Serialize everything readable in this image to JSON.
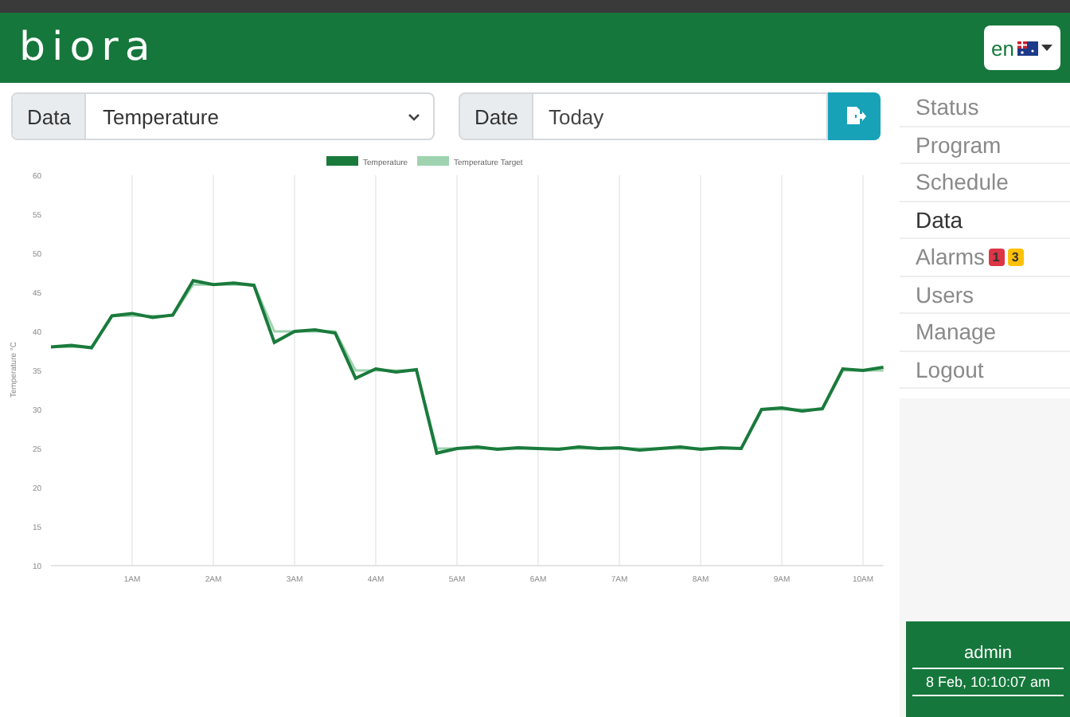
{
  "header": {
    "logo": "biora",
    "language": "en"
  },
  "controls": {
    "data_label": "Data",
    "data_value": "Temperature",
    "date_label": "Date",
    "date_value": "Today"
  },
  "chart": {
    "chart_data": {
      "type": "line",
      "ylabel": "Temperature °C",
      "x": [
        0,
        0.25,
        0.5,
        0.75,
        1,
        1.25,
        1.5,
        1.75,
        2,
        2.25,
        2.5,
        2.75,
        3,
        3.25,
        3.5,
        3.75,
        4,
        4.25,
        4.5,
        4.75,
        5,
        5.25,
        5.5,
        5.75,
        6,
        6.25,
        6.5,
        6.75,
        7,
        7.25,
        7.5,
        7.75,
        8,
        8.25,
        8.5,
        8.75,
        9,
        9.25,
        9.5,
        9.75,
        10,
        10.25
      ],
      "series": [
        {
          "name": "Temperature",
          "color": "#1a7a3c",
          "values": [
            38,
            38.2,
            37.9,
            42,
            42.3,
            41.8,
            42.1,
            46.5,
            46,
            46.2,
            45.9,
            38.6,
            40,
            40.2,
            39.8,
            34,
            35.2,
            34.8,
            35.1,
            24.4,
            25,
            25.2,
            24.9,
            25.1,
            25,
            24.9,
            25.2,
            25,
            25.1,
            24.8,
            25,
            25.2,
            24.9,
            25.1,
            25,
            30,
            30.2,
            29.8,
            30.1,
            35.2,
            35,
            35.4
          ]
        },
        {
          "name": "Temperature Target",
          "color": "#9fd3b0",
          "values": [
            38,
            38,
            38,
            42,
            42,
            42,
            42,
            46,
            46,
            46,
            46,
            40,
            40,
            40,
            40,
            35,
            35,
            35,
            35,
            25,
            25,
            25,
            25,
            25,
            25,
            25,
            25,
            25,
            25,
            25,
            25,
            25,
            25,
            25,
            25,
            30,
            30,
            30,
            30,
            35,
            35,
            35
          ]
        }
      ],
      "xlim": [
        0,
        10.25
      ],
      "ylim": [
        10,
        60
      ],
      "grid": true,
      "legend": "top",
      "xticks": [
        {
          "value": 1,
          "label": "1AM"
        },
        {
          "value": 2,
          "label": "2AM"
        },
        {
          "value": 3,
          "label": "3AM"
        },
        {
          "value": 4,
          "label": "4AM"
        },
        {
          "value": 5,
          "label": "5AM"
        },
        {
          "value": 6,
          "label": "6AM"
        },
        {
          "value": 7,
          "label": "7AM"
        },
        {
          "value": 8,
          "label": "8AM"
        },
        {
          "value": 9,
          "label": "9AM"
        },
        {
          "value": 10,
          "label": "10AM"
        }
      ],
      "yticks": [
        10,
        15,
        20,
        25,
        30,
        35,
        40,
        45,
        50,
        55,
        60
      ]
    }
  },
  "sidebar": {
    "items": [
      {
        "label": "Status",
        "selected": false
      },
      {
        "label": "Program",
        "selected": false
      },
      {
        "label": "Schedule",
        "selected": false
      },
      {
        "label": "Data",
        "selected": true
      },
      {
        "label": "Alarms",
        "selected": false,
        "badges": [
          {
            "text": "1",
            "color": "#dc3545"
          },
          {
            "text": "3",
            "color": "#ffc107"
          }
        ]
      },
      {
        "label": "Users",
        "selected": false
      },
      {
        "label": "Manage",
        "selected": false
      },
      {
        "label": "Logout",
        "selected": false
      }
    ],
    "user": "admin",
    "datetime": "8 Feb, 10:10:07 am"
  }
}
